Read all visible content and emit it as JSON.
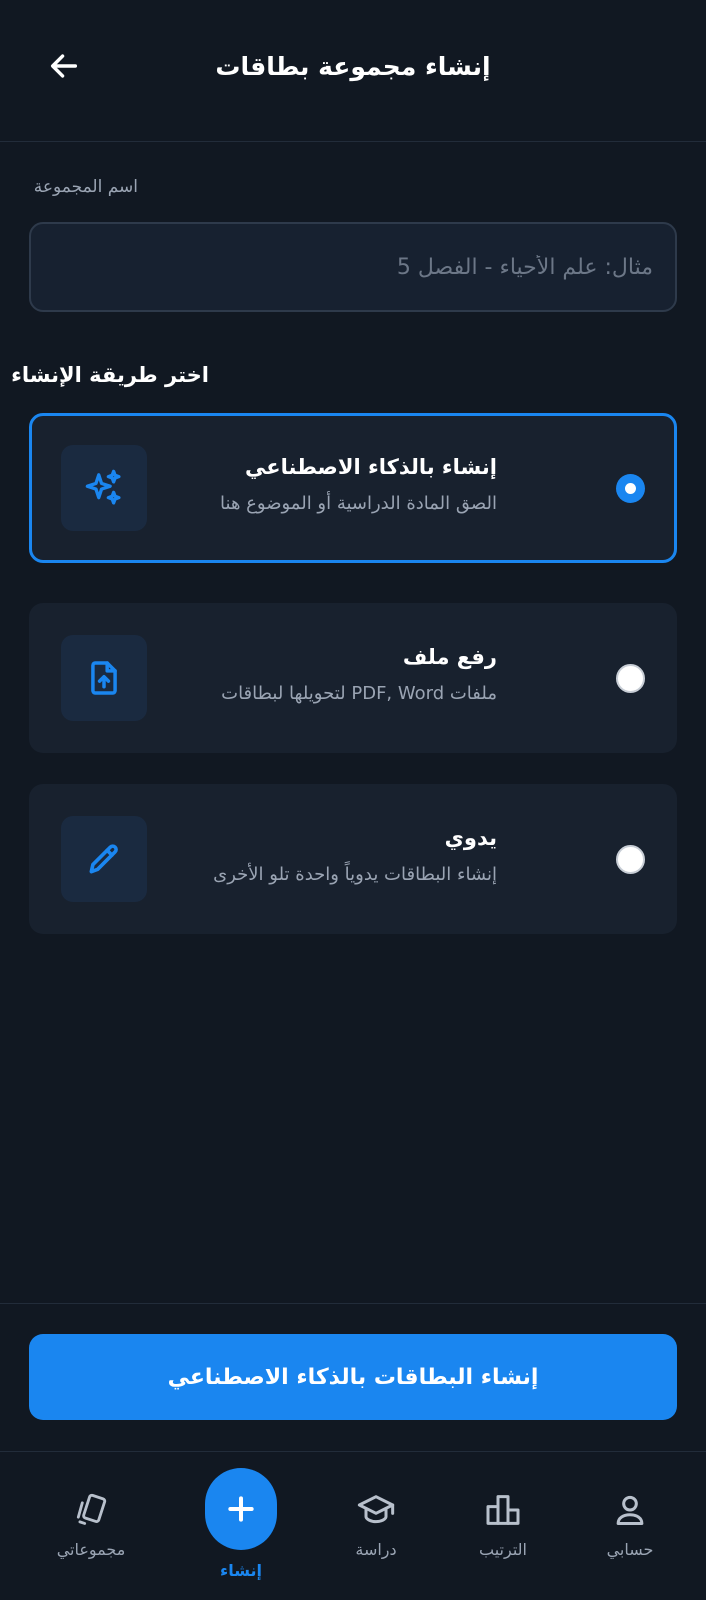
{
  "header": {
    "title": "إنشاء مجموعة بطاقات"
  },
  "form": {
    "name_label": "اسم المجموعة",
    "name_value": "",
    "name_placeholder": "مثال: علم الأحياء - الفصل 5"
  },
  "methods_section": {
    "title": "اختر طريقة الإنشاء",
    "selected": "ai",
    "items": [
      {
        "id": "ai",
        "title": "إنشاء بالذكاء الاصطناعي",
        "description": "الصق المادة الدراسية أو الموضوع هنا",
        "icon": "sparkles-icon"
      },
      {
        "id": "upload",
        "title": "رفع ملف",
        "description": "ملفات PDF, Word لتحويلها لبطاقات",
        "icon": "file-upload-icon"
      },
      {
        "id": "manual",
        "title": "يدوي",
        "description": "إنشاء البطاقات يدوياً واحدة تلو الأخرى",
        "icon": "pencil-icon"
      }
    ]
  },
  "cta": {
    "label": "إنشاء البطاقات بالذكاء الاصطناعي"
  },
  "nav": {
    "items": [
      {
        "id": "collections",
        "label": "مجموعاتي",
        "icon": "cards-icon"
      },
      {
        "id": "create",
        "label": "إنشاء",
        "icon": "plus-icon",
        "active": true
      },
      {
        "id": "study",
        "label": "دراسة",
        "icon": "graduation-cap-icon"
      },
      {
        "id": "ranking",
        "label": "الترتيب",
        "icon": "bar-chart-icon"
      },
      {
        "id": "account",
        "label": "حسابي",
        "icon": "user-icon"
      }
    ]
  },
  "colors": {
    "background": "#111822",
    "card": "#18212e",
    "accent": "#1a86f0",
    "muted_text": "#9aa4b3"
  }
}
